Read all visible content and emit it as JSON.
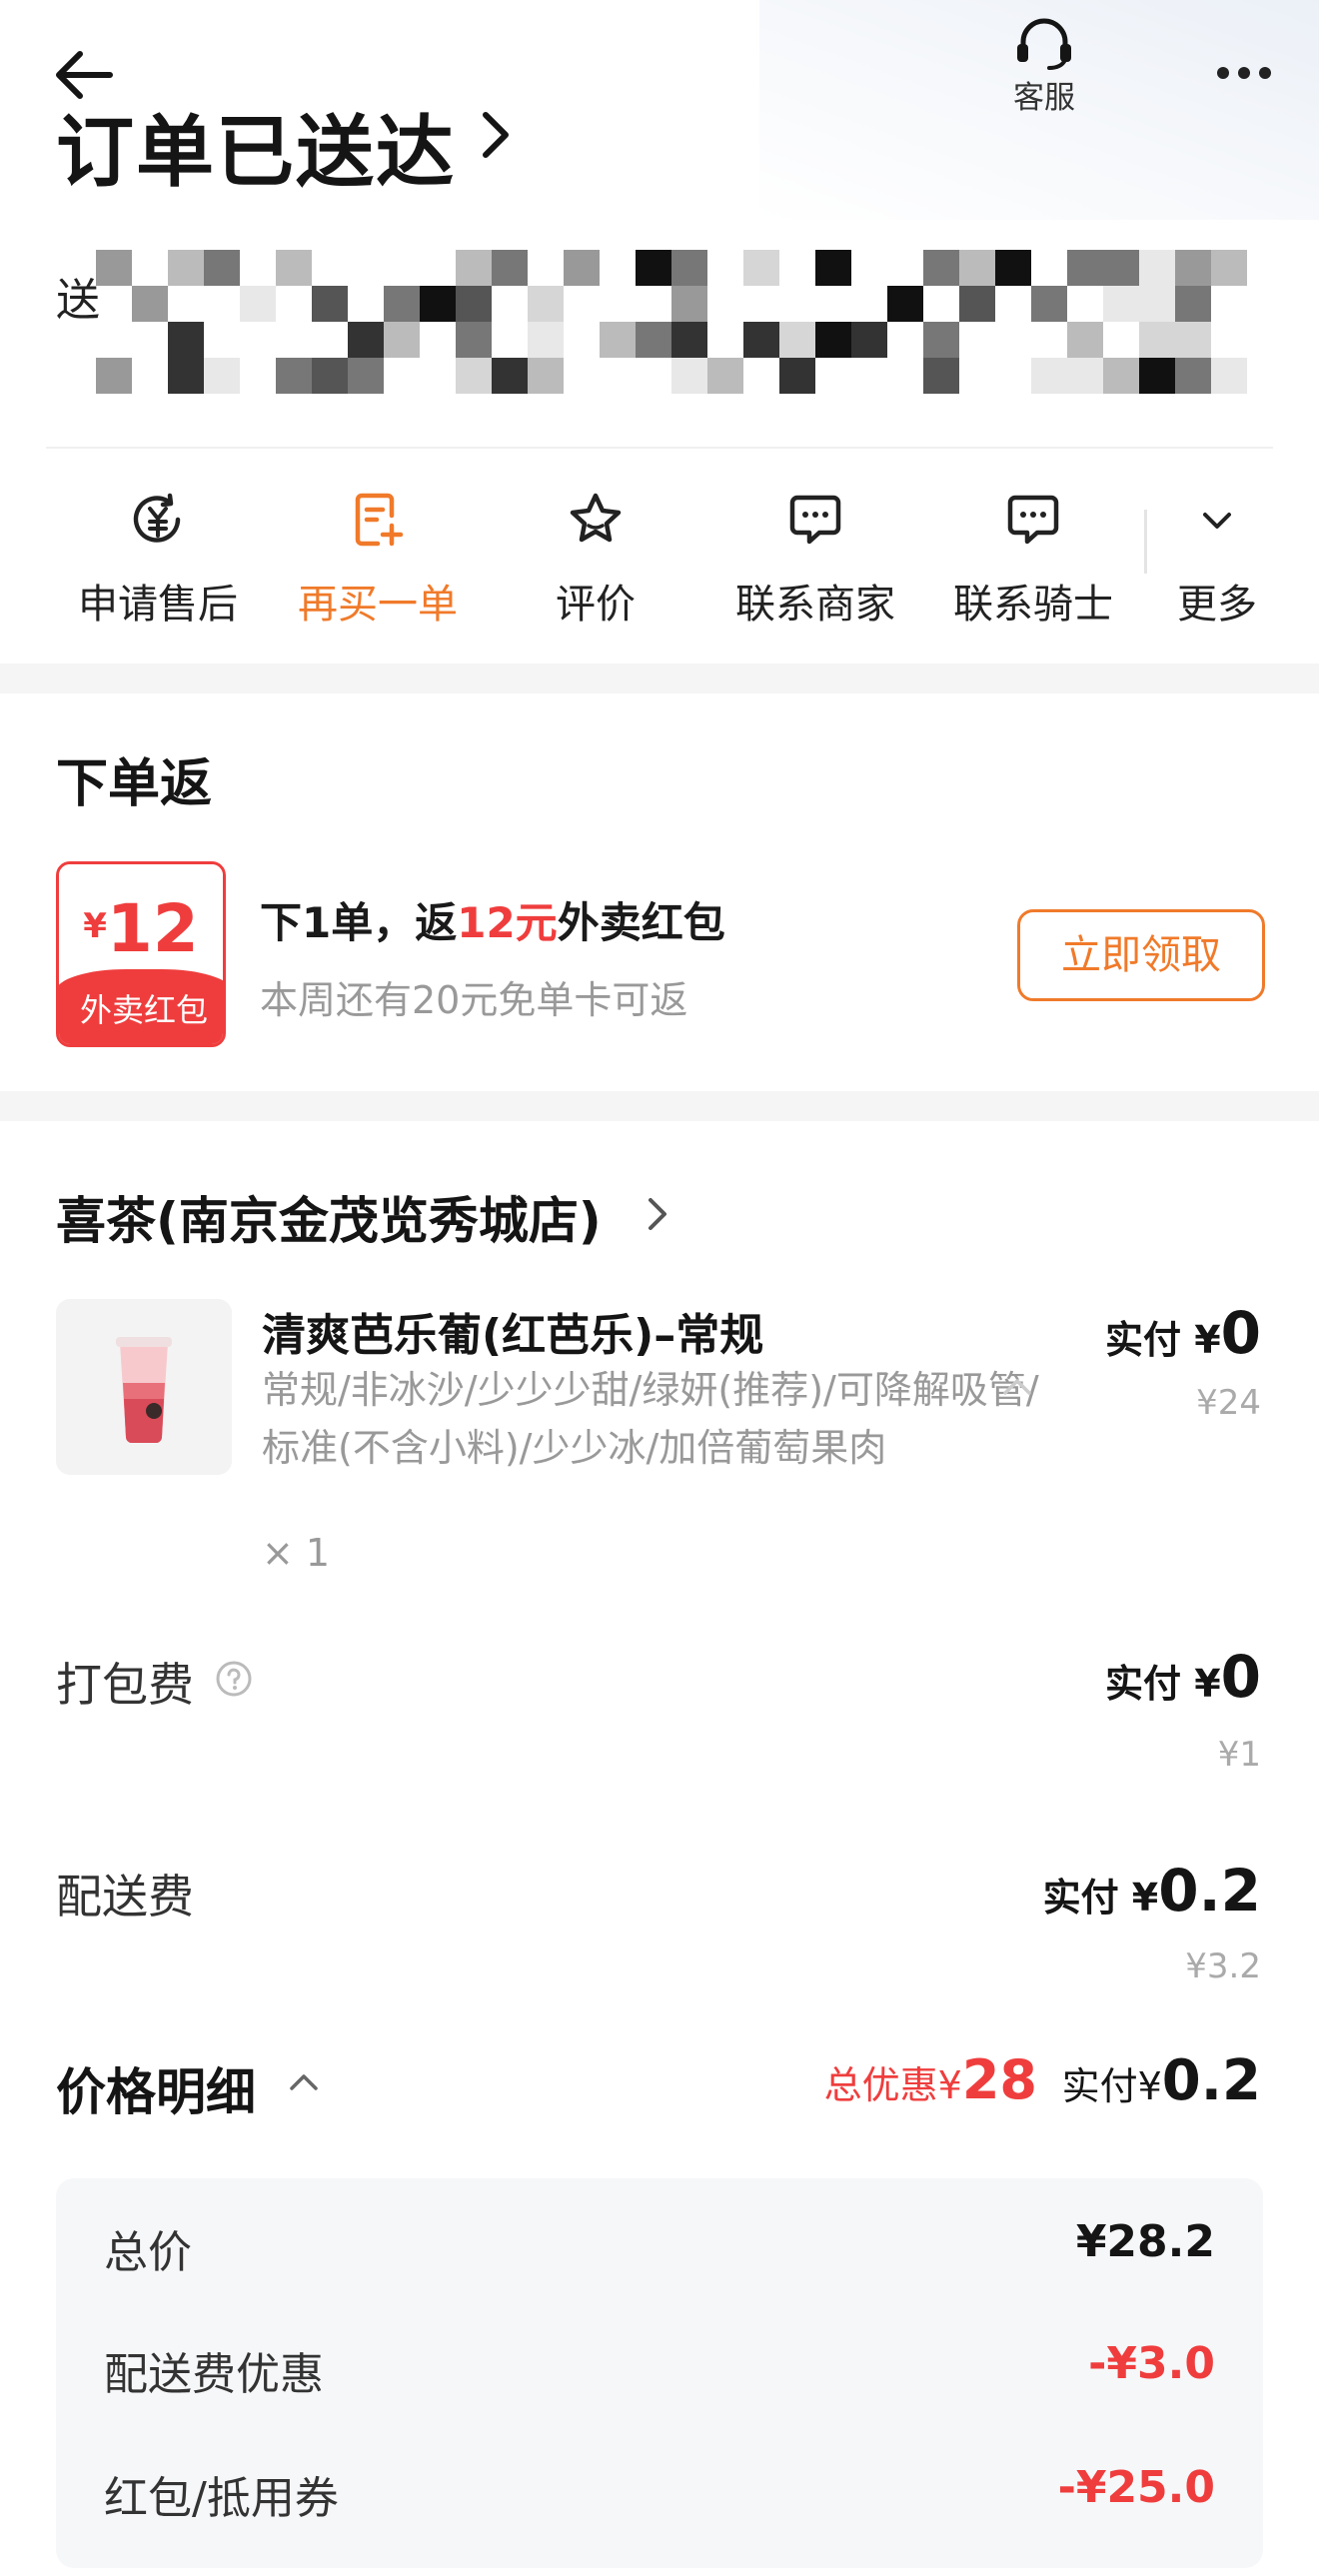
{
  "header": {
    "title": "订单已送达",
    "customer_service_label": "客服",
    "address_label": "送"
  },
  "actions": [
    {
      "label": "申请售后",
      "icon": "yen-refund-icon"
    },
    {
      "label": "再买一单",
      "icon": "reorder-icon",
      "highlight": "#f07a2a"
    },
    {
      "label": "评价",
      "icon": "star-icon"
    },
    {
      "label": "联系商家",
      "icon": "chat-icon"
    },
    {
      "label": "联系骑士",
      "icon": "chat-icon"
    },
    {
      "label": "更多",
      "icon": "chevron-down-icon"
    }
  ],
  "rebate": {
    "title": "下单返",
    "coupon_currency": "¥",
    "coupon_amount": "12",
    "coupon_label": "外卖红包",
    "main_prefix": "下1单，返",
    "main_amount": "12元",
    "main_suffix": "外卖红包",
    "sub_text": "本周还有20元免单卡可返",
    "claim_label": "立即领取"
  },
  "order": {
    "shop_name": "喜茶(南京金茂览秀城店)",
    "item": {
      "name": "清爽芭乐葡(红芭乐)–常规",
      "spec": "常规/非冰沙/少少少甜/绿妍(推荐)/可降解吸管/标准(不含小料)/少少冰/加倍葡萄果肉",
      "qty": "× 1",
      "paid_label": "实付 ¥",
      "paid_value": "0",
      "original_price": "¥24"
    },
    "packing": {
      "label": "打包费",
      "paid_label": "实付 ¥",
      "paid_value": "0",
      "original_price": "¥1"
    },
    "delivery": {
      "label": "配送费",
      "paid_label": "实付 ¥",
      "paid_value": "0.2",
      "original_price": "¥3.2"
    },
    "price_detail": {
      "title": "价格明细",
      "discount_label": "总优惠¥",
      "discount_value": "28",
      "paid_label": "实付¥",
      "paid_value": "0.2",
      "rows": [
        {
          "label": "总价",
          "value": "¥28.2"
        },
        {
          "label": "配送费优惠",
          "value": "-¥3.0"
        },
        {
          "label": "红包/抵用券",
          "value": "-¥25.0"
        }
      ]
    }
  },
  "colors": {
    "accent_orange": "#f07a2a",
    "accent_red": "#ef3d3d"
  }
}
